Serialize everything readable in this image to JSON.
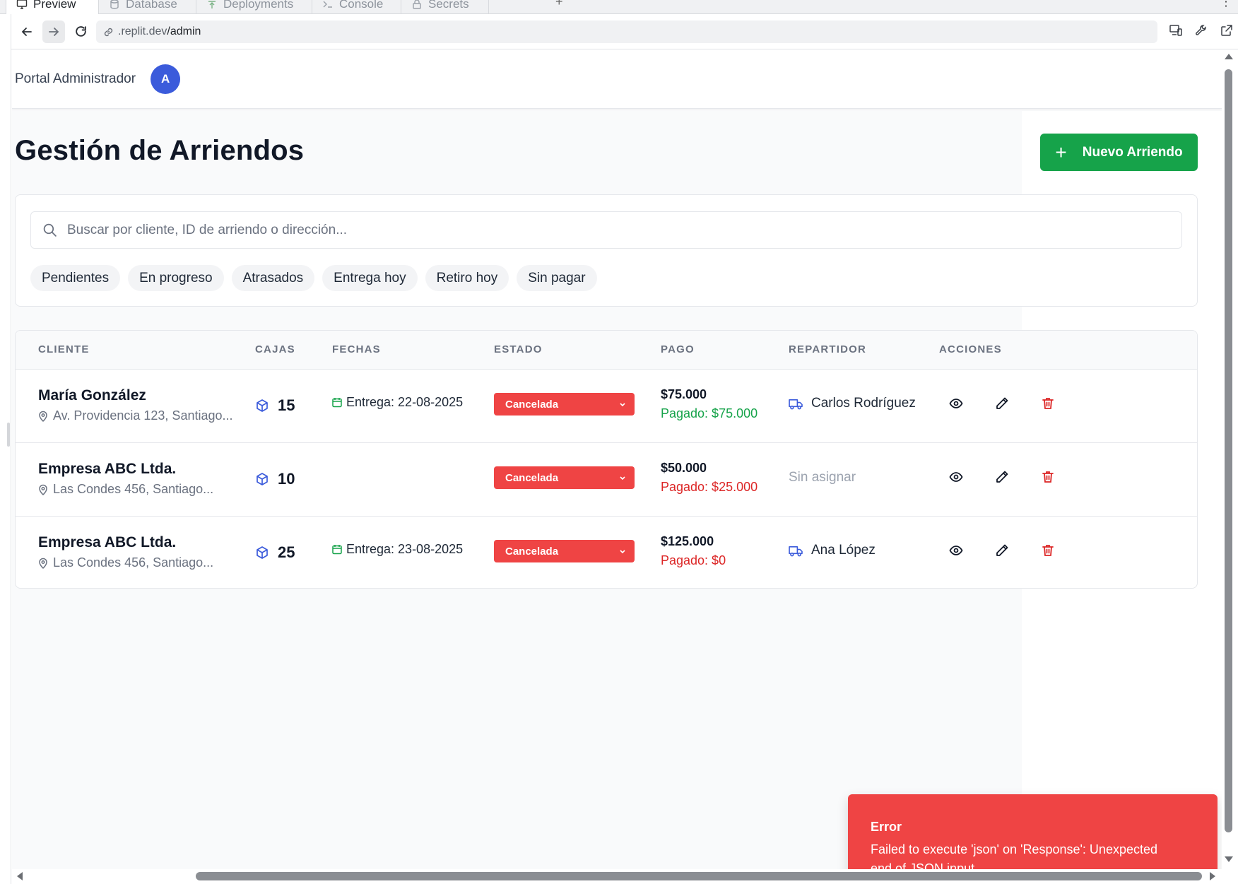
{
  "ide": {
    "tabs": [
      {
        "label": "Preview",
        "icon": "monitor-icon"
      },
      {
        "label": "Database",
        "icon": "database-icon"
      },
      {
        "label": "Deployments",
        "icon": "deploy-icon"
      },
      {
        "label": "Console",
        "icon": "console-icon"
      },
      {
        "label": "Secrets",
        "icon": "lock-icon"
      }
    ],
    "add_tab": "+",
    "more": "⋮"
  },
  "browser": {
    "url_domain": ".replit.dev",
    "url_path": "/admin"
  },
  "header": {
    "portal_title": "Portal Administrador",
    "avatar_initial": "A"
  },
  "page": {
    "title": "Gestión de Arriendos",
    "new_button": "Nuevo Arriendo",
    "new_button_plus": "+"
  },
  "search": {
    "placeholder": "Buscar por cliente, ID de arriendo o dirección..."
  },
  "filters": [
    "Pendientes",
    "En progreso",
    "Atrasados",
    "Entrega hoy",
    "Retiro hoy",
    "Sin pagar"
  ],
  "table": {
    "columns": [
      "CLIENTE",
      "CAJAS",
      "FECHAS",
      "ESTADO",
      "PAGO",
      "REPARTIDOR",
      "ACCIONES"
    ],
    "rows": [
      {
        "client": "María González",
        "address": "Av. Providencia 123, Santiago...",
        "boxes": "15",
        "date": "Entrega: 22-08-2025",
        "status": "Cancelada",
        "total": "$75.000",
        "paid": "Pagado: $75.000",
        "paid_state": "ok",
        "driver": "Carlos Rodríguez",
        "driver_assigned": true
      },
      {
        "client": "Empresa ABC Ltda.",
        "address": "Las Condes 456, Santiago...",
        "boxes": "10",
        "date": "",
        "status": "Cancelada",
        "total": "$50.000",
        "paid": "Pagado: $25.000",
        "paid_state": "due",
        "driver": "Sin asignar",
        "driver_assigned": false
      },
      {
        "client": "Empresa ABC Ltda.",
        "address": "Las Condes 456, Santiago...",
        "boxes": "25",
        "date": "Entrega: 23-08-2025",
        "status": "Cancelada",
        "total": "$125.000",
        "paid": "Pagado: $0",
        "paid_state": "due",
        "driver": "Ana López",
        "driver_assigned": true
      }
    ]
  },
  "toast": {
    "title": "Error",
    "message": "Failed to execute 'json' on 'Response': Unexpected end of JSON input"
  },
  "colors": {
    "accent_green": "#16a34a",
    "status_red": "#ef4444",
    "avatar_blue": "#3b5bdb",
    "paid_ok": "#16a34a",
    "paid_due": "#dc2626"
  }
}
